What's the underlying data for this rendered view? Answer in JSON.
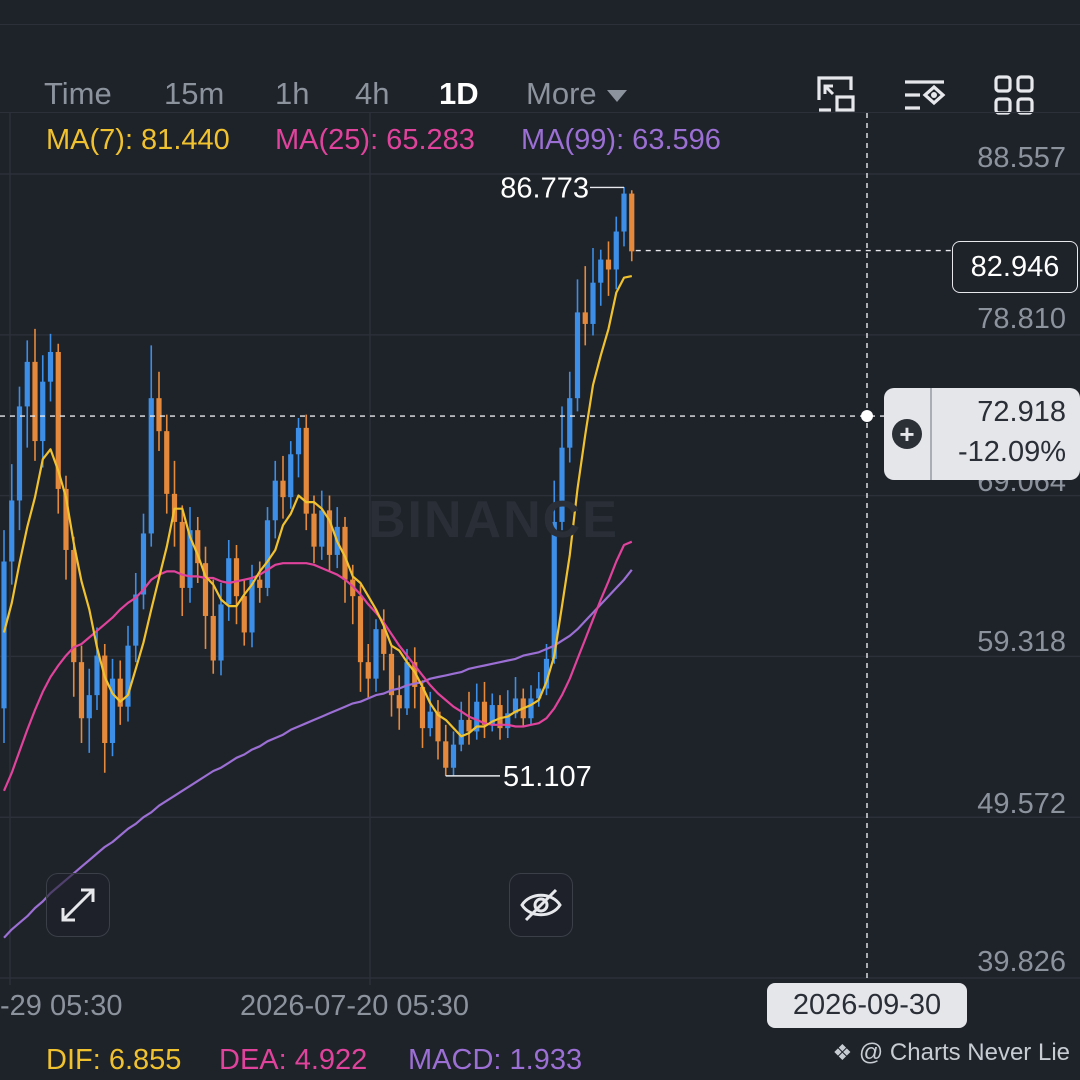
{
  "toolbar": {
    "tabs": [
      {
        "label": "Time",
        "active": false
      },
      {
        "label": "15m",
        "active": false
      },
      {
        "label": "1h",
        "active": false
      },
      {
        "label": "4h",
        "active": false
      },
      {
        "label": "1D",
        "active": true
      },
      {
        "label": "More",
        "active": false
      }
    ],
    "icons": [
      "picture-in-picture-icon",
      "indicator-settings-icon",
      "grid-layout-icon"
    ]
  },
  "indicators": {
    "ma7": "MA(7): 81.440",
    "ma25": "MA(25): 65.283",
    "ma99": "MA(99): 63.596",
    "dif": "DIF: 6.855",
    "dea": "DEA: 4.922",
    "macd": "MACD: 1.933"
  },
  "colors": {
    "up": "#3d8ee6",
    "down": "#e58a3c",
    "ma7": "#f0c230",
    "ma25": "#e0439c",
    "ma99": "#9b6fd3",
    "grid": "#2b3039",
    "background": "#1e2229"
  },
  "watermark": "BINANCE",
  "last_price": "82.946",
  "crosshair": {
    "price": "72.918",
    "change": "-12.09%",
    "time": "2026-09-30"
  },
  "credit": "@ Charts Never Lie",
  "chart_data": {
    "type": "candlestick",
    "y_axis_ticks": [
      "88.557",
      "78.810",
      "69.064",
      "59.318",
      "49.572",
      "39.826"
    ],
    "ylim": [
      39.826,
      88.557
    ],
    "x_axis_ticks": [
      "-29 05:30",
      "2026-07-20 05:30"
    ],
    "annotations": {
      "high": "86.773",
      "low": "51.107"
    },
    "candles": [
      [
        55.2,
        64.1,
        53.1,
        66.0
      ],
      [
        64.1,
        67.8,
        62.7,
        70.0
      ],
      [
        67.8,
        73.5,
        66.0,
        74.7
      ],
      [
        73.5,
        76.2,
        71.0,
        77.5
      ],
      [
        76.2,
        71.4,
        70.2,
        78.2
      ],
      [
        71.4,
        75.0,
        69.8,
        76.6
      ],
      [
        75.0,
        76.8,
        73.8,
        77.9
      ],
      [
        76.8,
        68.5,
        67.0,
        77.3
      ],
      [
        68.5,
        64.8,
        63.0,
        69.3
      ],
      [
        64.8,
        58.0,
        55.9,
        65.6
      ],
      [
        58.0,
        54.6,
        53.1,
        59.0
      ],
      [
        54.6,
        56.0,
        52.5,
        57.6
      ],
      [
        56.0,
        58.4,
        55.1,
        60.1
      ],
      [
        58.4,
        53.1,
        51.3,
        59.1
      ],
      [
        53.1,
        57.0,
        52.3,
        58.2
      ],
      [
        57.0,
        55.3,
        54.2,
        58.1
      ],
      [
        55.3,
        59.0,
        54.4,
        60.2
      ],
      [
        59.0,
        62.1,
        58.0,
        63.4
      ],
      [
        62.1,
        65.8,
        61.2,
        67.0
      ],
      [
        65.8,
        74.0,
        65.0,
        77.2
      ],
      [
        74.0,
        72.0,
        70.8,
        75.6
      ],
      [
        72.0,
        68.2,
        67.0,
        73.0
      ],
      [
        68.2,
        66.5,
        65.0,
        70.2
      ],
      [
        66.5,
        62.5,
        60.8,
        67.5
      ],
      [
        62.5,
        66.0,
        61.6,
        67.4
      ],
      [
        66.0,
        64.0,
        62.8,
        66.8
      ],
      [
        64.0,
        60.8,
        58.8,
        65.0
      ],
      [
        60.8,
        58.1,
        57.3,
        63.0
      ],
      [
        58.1,
        61.5,
        57.2,
        62.8
      ],
      [
        61.5,
        64.3,
        60.5,
        65.4
      ],
      [
        64.3,
        62.0,
        60.3,
        65.1
      ],
      [
        62.0,
        59.8,
        59.0,
        63.0
      ],
      [
        59.8,
        63.0,
        58.9,
        63.9
      ],
      [
        63.0,
        62.5,
        61.6,
        64.1
      ],
      [
        62.5,
        66.6,
        62.0,
        67.4
      ],
      [
        66.6,
        69.0,
        65.5,
        70.2
      ],
      [
        69.0,
        68.0,
        66.7,
        70.5
      ],
      [
        68.0,
        70.6,
        67.3,
        71.4
      ],
      [
        70.6,
        72.2,
        69.2,
        72.8
      ],
      [
        72.2,
        67.0,
        66.0,
        73.0
      ],
      [
        67.0,
        65.0,
        64.0,
        68.1
      ],
      [
        65.0,
        67.2,
        64.2,
        68.4
      ],
      [
        67.2,
        64.5,
        63.5,
        68.1
      ],
      [
        64.5,
        66.2,
        63.7,
        67.4
      ],
      [
        66.2,
        63.0,
        61.6,
        66.8
      ],
      [
        63.0,
        62.0,
        60.3,
        63.9
      ],
      [
        62.0,
        58.0,
        56.2,
        62.7
      ],
      [
        58.0,
        57.0,
        55.8,
        59.1
      ],
      [
        57.0,
        60.0,
        56.2,
        60.6
      ],
      [
        60.0,
        58.5,
        57.5,
        61.2
      ],
      [
        58.5,
        56.0,
        54.7,
        59.0
      ],
      [
        56.0,
        55.2,
        53.9,
        57.2
      ],
      [
        55.2,
        58.0,
        54.8,
        58.8
      ],
      [
        58.0,
        56.5,
        55.2,
        58.9
      ],
      [
        56.5,
        54.0,
        52.8,
        56.9
      ],
      [
        54.0,
        55.0,
        53.5,
        56.2
      ],
      [
        55.0,
        53.2,
        52.1,
        55.7
      ],
      [
        53.2,
        51.6,
        51.1,
        54.2
      ],
      [
        51.6,
        53.0,
        51.1,
        53.8
      ],
      [
        53.0,
        54.5,
        52.6,
        55.6
      ],
      [
        54.5,
        53.8,
        53.0,
        56.2
      ],
      [
        53.8,
        55.6,
        53.3,
        56.7
      ],
      [
        55.6,
        54.2,
        53.4,
        56.8
      ],
      [
        54.2,
        55.4,
        53.8,
        56.1
      ],
      [
        55.4,
        54.0,
        53.3,
        56.0
      ],
      [
        54.0,
        54.9,
        53.4,
        56.3
      ],
      [
        54.9,
        55.8,
        54.6,
        57.1
      ],
      [
        55.8,
        54.6,
        54.1,
        56.4
      ],
      [
        54.6,
        55.8,
        54.2,
        56.6
      ],
      [
        55.8,
        56.4,
        55.3,
        57.4
      ],
      [
        56.4,
        58.2,
        56.0,
        59.1
      ],
      [
        58.2,
        66.5,
        57.9,
        69.0
      ],
      [
        66.5,
        71.0,
        66.0,
        73.5
      ],
      [
        71.0,
        74.0,
        70.1,
        75.6
      ],
      [
        74.0,
        79.2,
        73.2,
        81.2
      ],
      [
        79.2,
        78.5,
        77.2,
        82.0
      ],
      [
        78.5,
        81.0,
        77.8,
        83.1
      ],
      [
        81.0,
        82.4,
        79.6,
        83.0
      ],
      [
        82.4,
        81.8,
        80.2,
        83.5
      ],
      [
        81.8,
        84.1,
        80.6,
        85.0
      ],
      [
        84.1,
        86.4,
        83.2,
        86.8
      ],
      [
        86.4,
        82.9,
        82.3,
        86.6
      ]
    ],
    "ma7": [
      59.8,
      61.6,
      64.0,
      66.2,
      68.0,
      70.3,
      70.9,
      69.6,
      68.0,
      65.2,
      62.9,
      61.2,
      58.9,
      57.1,
      56.1,
      55.6,
      56.0,
      57.6,
      59.2,
      61.2,
      63.1,
      65.0,
      67.3,
      67.3,
      65.6,
      64.5,
      63.2,
      62.7,
      61.8,
      61.4,
      61.4,
      62.1,
      62.7,
      63.5,
      64.1,
      64.8,
      66.3,
      67.0,
      68.1,
      67.7,
      67.7,
      67.3,
      66.6,
      65.3,
      64.4,
      63.2,
      62.8,
      62.0,
      61.2,
      60.2,
      59.0,
      58.7,
      58.0,
      57.4,
      56.5,
      55.5,
      54.8,
      54.5,
      54.0,
      53.5,
      53.7,
      54.1,
      54.1,
      54.4,
      54.6,
      54.7,
      55.0,
      55.2,
      55.4,
      55.7,
      56.8,
      58.4,
      61.4,
      64.5,
      68.5,
      71.8,
      74.8,
      76.6,
      78.2,
      80.4,
      81.3,
      81.4
    ],
    "ma25": [
      50.2,
      51.3,
      52.6,
      53.9,
      55.1,
      56.2,
      57.1,
      57.8,
      58.4,
      58.9,
      59.1,
      59.5,
      59.9,
      60.3,
      60.7,
      61.2,
      61.6,
      61.9,
      62.4,
      63.0,
      63.3,
      63.5,
      63.5,
      63.3,
      63.2,
      63.2,
      63.1,
      63.1,
      62.9,
      62.8,
      62.9,
      63.0,
      63.1,
      63.3,
      63.6,
      63.9,
      64.0,
      64.0,
      64.0,
      64.0,
      63.9,
      63.7,
      63.5,
      63.3,
      63.0,
      62.6,
      62.1,
      61.5,
      61.0,
      60.4,
      59.7,
      59.0,
      58.4,
      57.8,
      57.2,
      56.6,
      56.1,
      55.7,
      55.3,
      55.0,
      54.7,
      54.5,
      54.3,
      54.2,
      54.2,
      54.2,
      54.1,
      54.1,
      54.2,
      54.3,
      54.6,
      55.2,
      56.0,
      57.0,
      58.2,
      59.4,
      60.6,
      61.8,
      62.9,
      64.1,
      65.1,
      65.3
    ],
    "ma99": [
      41.3,
      41.8,
      42.2,
      42.6,
      43.1,
      43.5,
      44.0,
      44.4,
      44.8,
      45.2,
      45.6,
      46.0,
      46.4,
      46.8,
      47.1,
      47.5,
      47.9,
      48.2,
      48.6,
      48.9,
      49.3,
      49.6,
      49.9,
      50.2,
      50.5,
      50.8,
      51.1,
      51.4,
      51.6,
      51.9,
      52.2,
      52.4,
      52.7,
      52.9,
      53.2,
      53.4,
      53.6,
      53.9,
      54.1,
      54.3,
      54.5,
      54.7,
      54.9,
      55.1,
      55.3,
      55.5,
      55.6,
      55.8,
      56.0,
      56.1,
      56.3,
      56.4,
      56.6,
      56.7,
      56.8,
      57.0,
      57.1,
      57.2,
      57.3,
      57.4,
      57.6,
      57.7,
      57.8,
      57.9,
      58.0,
      58.1,
      58.2,
      58.4,
      58.5,
      58.6,
      58.8,
      59.0,
      59.3,
      59.6,
      60.0,
      60.5,
      61.0,
      61.5,
      62.0,
      62.5,
      63.0,
      63.6
    ]
  }
}
